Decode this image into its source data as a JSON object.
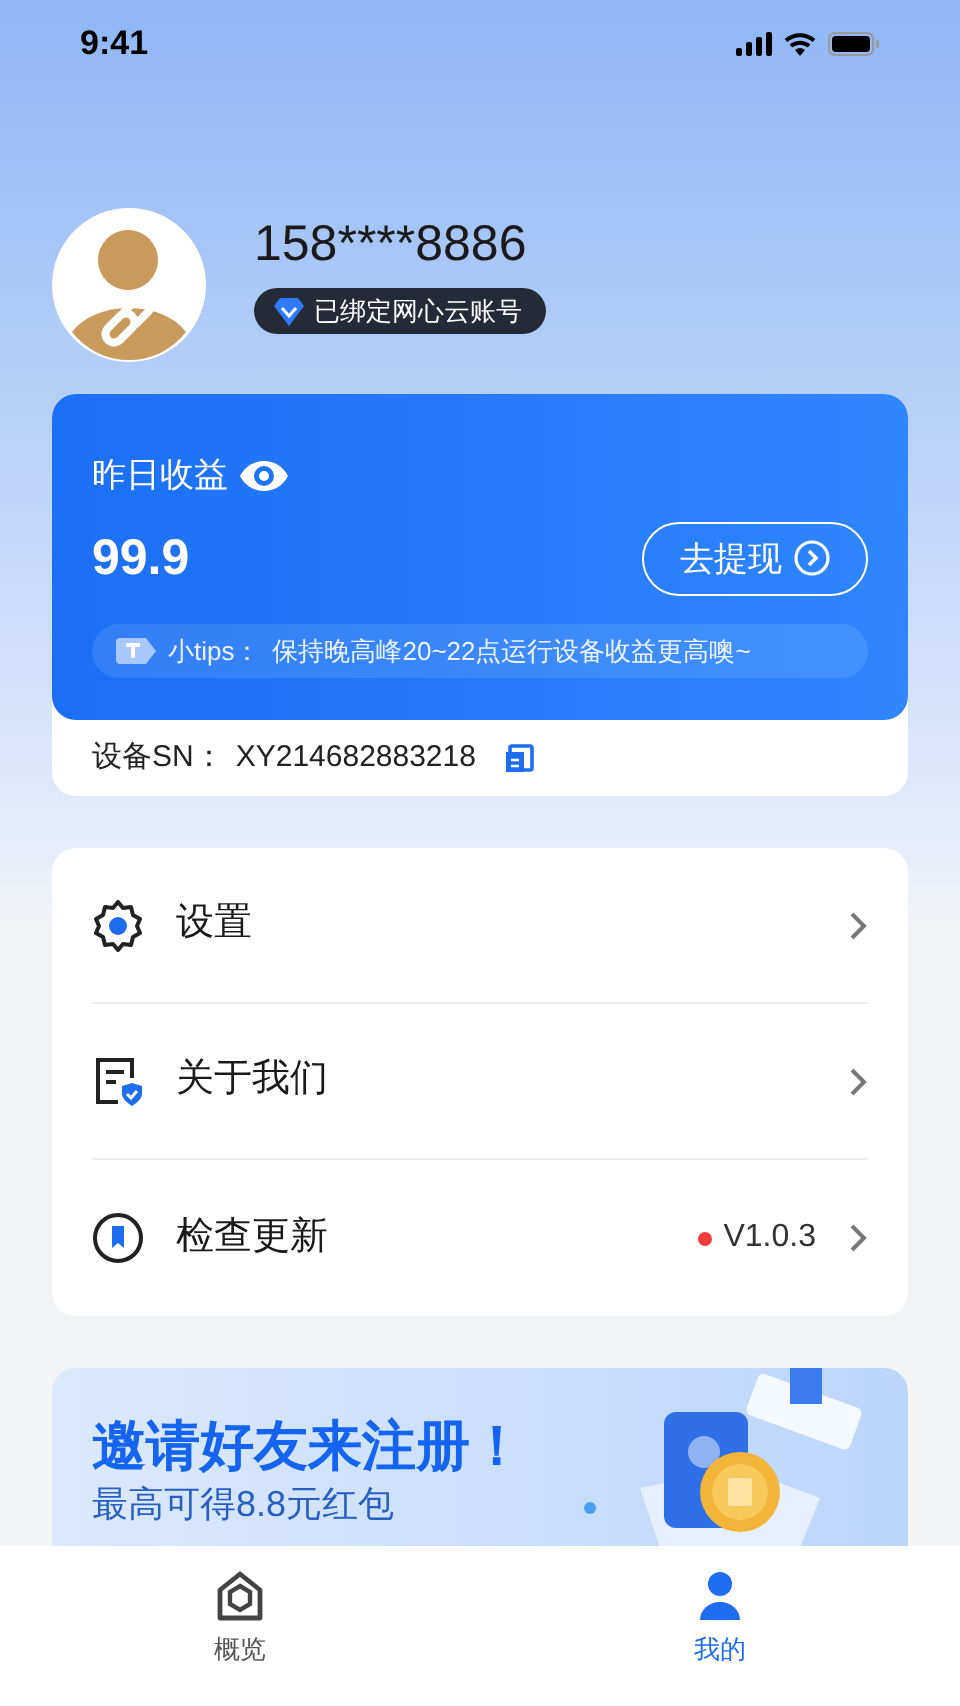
{
  "status_bar": {
    "time": "9:41"
  },
  "profile": {
    "phone": "158****8886",
    "badge": "已绑定网心云账号"
  },
  "earnings": {
    "label": "昨日收益",
    "amount": "99.9",
    "withdraw_button": "去提现",
    "tip_label": "小tips：",
    "tip": "保持晚高峰20~22点运行设备收益更高噢~",
    "device_sn_label": "设备SN：",
    "device_sn": "XY214682883218"
  },
  "menu": [
    {
      "kind": "settings",
      "label": "设置"
    },
    {
      "kind": "about",
      "label": "关于我们"
    },
    {
      "kind": "update",
      "label": "检查更新",
      "version": "V1.0.3",
      "has_update": true
    }
  ],
  "banner": {
    "title": "邀请好友来注册！",
    "subtitle": "最高可得8.8元红包"
  },
  "tabs": [
    {
      "kind": "overview",
      "label": "概览",
      "selected": false
    },
    {
      "kind": "mine",
      "label": "我的",
      "selected": true
    }
  ]
}
